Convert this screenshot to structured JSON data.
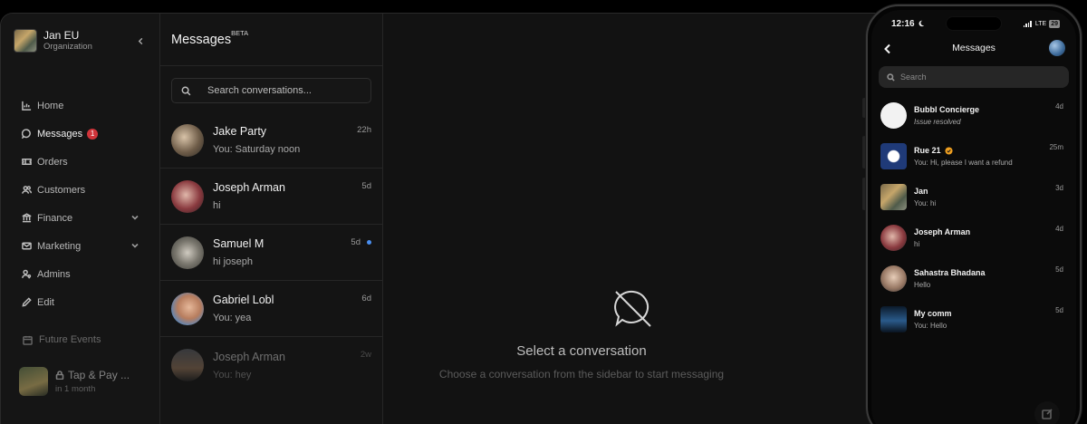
{
  "sidebar": {
    "org_name": "Jan EU",
    "org_sub": "Organization",
    "items": [
      {
        "label": "Home",
        "icon": "home-chart-icon"
      },
      {
        "label": "Messages",
        "icon": "chat-bubble-icon",
        "badge": "1"
      },
      {
        "label": "Orders",
        "icon": "ticket-icon"
      },
      {
        "label": "Customers",
        "icon": "users-icon"
      },
      {
        "label": "Finance",
        "icon": "bank-icon",
        "expandable": true
      },
      {
        "label": "Marketing",
        "icon": "mail-icon",
        "expandable": true
      },
      {
        "label": "Admins",
        "icon": "user-key-icon"
      },
      {
        "label": "Edit",
        "icon": "pencil-icon"
      }
    ],
    "future_events_label": "Future Events",
    "event": {
      "title": "Tap & Pay ...",
      "sub": "in 1 month"
    }
  },
  "conversations": {
    "title": "Messages",
    "beta": "BETA",
    "search_placeholder": "Search conversations...",
    "items": [
      {
        "name": "Jake Party",
        "preview": "You: Saturday noon",
        "time": "22h",
        "unread": false
      },
      {
        "name": "Joseph Arman",
        "preview": "hi",
        "time": "5d",
        "unread": false
      },
      {
        "name": "Samuel M",
        "preview": "hi joseph",
        "time": "5d",
        "unread": true
      },
      {
        "name": "Gabriel Lobl",
        "preview": "You: yea",
        "time": "6d",
        "unread": false
      },
      {
        "name": "Joseph Arman",
        "preview": "You: hey",
        "time": "2w",
        "unread": false
      }
    ]
  },
  "empty_state": {
    "title": "Select a conversation",
    "subtitle": "Choose a conversation from the sidebar to start messaging"
  },
  "phone": {
    "time": "12:16",
    "network": "LTE",
    "battery": "29",
    "title": "Messages",
    "search_placeholder": "Search",
    "items": [
      {
        "name": "Bubbl Concierge",
        "preview": "Issue resolved",
        "time": "4d"
      },
      {
        "name": "Rue 21",
        "preview": "You: Hi, please I want a refund",
        "time": "25m",
        "verified": true
      },
      {
        "name": "Jan",
        "preview": "You: hi",
        "time": "3d"
      },
      {
        "name": "Joseph Arman",
        "preview": "hi",
        "time": "4d"
      },
      {
        "name": "Sahastra Bhadana",
        "preview": "Hello",
        "time": "5d"
      },
      {
        "name": "My comm",
        "preview": "You: Hello",
        "time": "5d"
      }
    ]
  },
  "colors": {
    "badge": "#d0343a",
    "unread_dot": "#4a8ff0",
    "background": "#131313",
    "verified": "#f0a020"
  }
}
